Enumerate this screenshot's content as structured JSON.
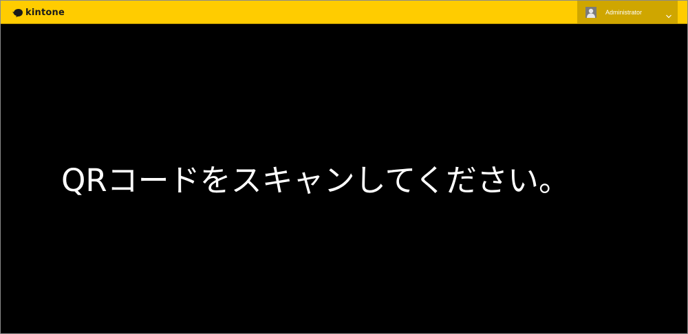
{
  "header": {
    "logo_text": "kintone",
    "logo_icon": "kintone-bird-icon",
    "background_color": "#ffcc00",
    "user": {
      "name": "Administrator",
      "avatar_icon": "user-avatar-icon",
      "menu_icon": "chevron-down-icon"
    }
  },
  "main": {
    "message": "QRコードをスキャンしてください。"
  }
}
